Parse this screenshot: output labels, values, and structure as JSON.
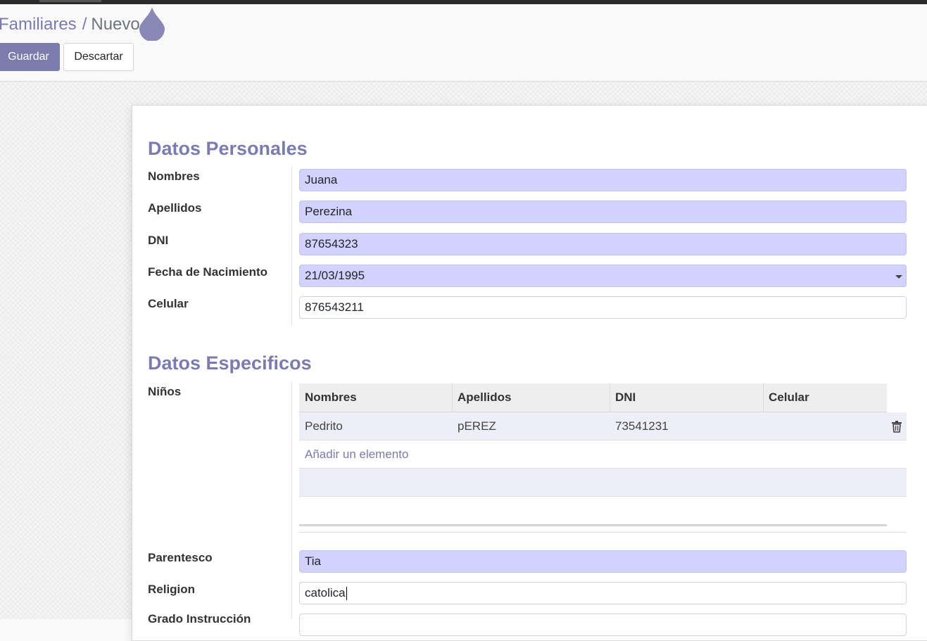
{
  "breadcrumb": {
    "parent": "Familiares",
    "separator": "/",
    "current": "Nuevo"
  },
  "buttons": {
    "save": "Guardar",
    "discard": "Descartar"
  },
  "sections": {
    "personal": "Datos Personales",
    "specific": "Datos Especificos"
  },
  "fields": {
    "nombres": {
      "label": "Nombres",
      "value": "Juana"
    },
    "apellidos": {
      "label": "Apellidos",
      "value": "Perezina"
    },
    "dni": {
      "label": "DNI",
      "value": "87654323"
    },
    "fecha": {
      "label": "Fecha de Nacimiento",
      "value": "21/03/1995"
    },
    "celular": {
      "label": "Celular",
      "value": "876543211"
    },
    "ninos": {
      "label": "Niños"
    },
    "parentesco": {
      "label": "Parentesco",
      "value": "Tia"
    },
    "religion": {
      "label": "Religion",
      "value": "catolica"
    },
    "grado": {
      "label": "Grado Instrucción"
    }
  },
  "children_table": {
    "headers": [
      "Nombres",
      "Apellidos",
      "DNI",
      "Celular"
    ],
    "rows": [
      {
        "nombres": "Pedrito",
        "apellidos": "pEREZ",
        "dni": "73541231",
        "celular": ""
      }
    ],
    "add_link": "Añadir un elemento"
  },
  "colors": {
    "accent": "#7c7bad",
    "required_field": "#d2d2ff"
  },
  "icons": [
    "drop-icon",
    "caret-down-icon",
    "trash-icon"
  ]
}
